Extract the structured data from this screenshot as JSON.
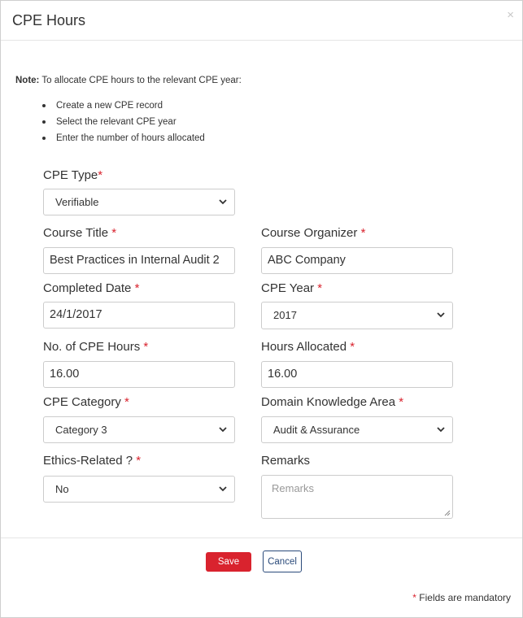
{
  "dialog": {
    "title": "CPE Hours",
    "close_icon": "×"
  },
  "note": {
    "prefix": "Note:",
    "text": " To allocate CPE hours to the relevant CPE year:",
    "items": [
      "Create a new CPE record",
      "Select the relevant CPE year",
      "Enter the number of hours allocated"
    ]
  },
  "form": {
    "required_mark": "*",
    "cpe_type": {
      "label": "CPE Type",
      "value": "Verifiable"
    },
    "course_title": {
      "label": "Course Title ",
      "value": "Best Practices in Internal Audit 2"
    },
    "course_organizer": {
      "label": "Course Organizer ",
      "value": "ABC Company"
    },
    "completed_date": {
      "label": "Completed Date ",
      "value": "24/1/2017"
    },
    "cpe_year": {
      "label": "CPE Year ",
      "value": "2017"
    },
    "cpe_hours": {
      "label": "No. of CPE Hours ",
      "value": "16.00"
    },
    "hours_allocated": {
      "label": "Hours Allocated ",
      "value": "16.00"
    },
    "cpe_category": {
      "label": "CPE Category ",
      "value": "Category 3"
    },
    "domain_area": {
      "label": "Domain Knowledge Area ",
      "value": "Audit & Assurance"
    },
    "ethics": {
      "label": "Ethics-Related ? ",
      "value": "No"
    },
    "remarks": {
      "label": "Remarks",
      "placeholder": "Remarks"
    }
  },
  "footer": {
    "save_label": "Save",
    "cancel_label": "Cancel",
    "mandatory_mark": "*",
    "mandatory_text": " Fields are mandatory"
  },
  "colors": {
    "required": "#d9232e",
    "save_button": "#d9232e",
    "cancel_border": "#2a4a7a"
  },
  "icons": {
    "dropdown": "chevron-down-icon",
    "close": "close-icon",
    "resize": "resize-handle-icon"
  }
}
